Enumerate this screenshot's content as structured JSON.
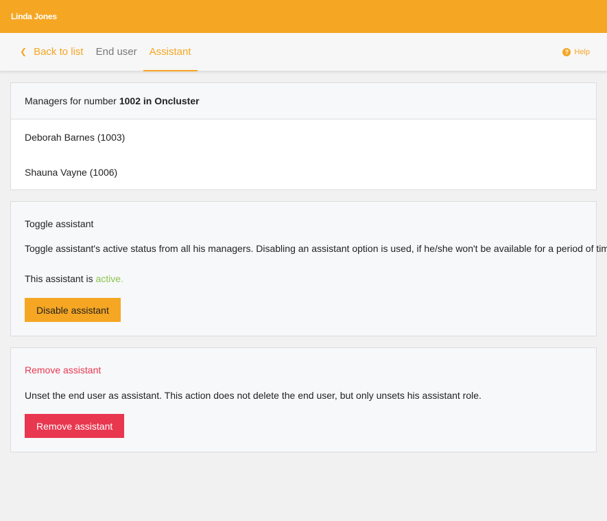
{
  "header": {
    "user_name": "Linda Jones"
  },
  "nav": {
    "back_label": "Back to list",
    "tabs": [
      {
        "label": "End user",
        "active": false
      },
      {
        "label": "Assistant",
        "active": true
      }
    ],
    "help_label": "Help"
  },
  "managers": {
    "header_prefix": "Managers for number",
    "header_number": "1002 in Oncluster",
    "items": [
      {
        "label": "Deborah Barnes (1003)"
      },
      {
        "label": "Shauna Vayne (1006)"
      }
    ]
  },
  "toggle": {
    "title": "Toggle assistant",
    "description": "Toggle assistant's active status from all his managers. Disabling an assistant option is used, if he/she won't be available for a period of time.",
    "status_prefix": "This assistant is",
    "status_value": "active.",
    "button_label": "Disable assistant"
  },
  "remove": {
    "title": "Remove assistant",
    "description": "Unset the end user as assistant. This action does not delete the end user, but only unsets his assistant role.",
    "button_label": "Remove assistant"
  },
  "colors": {
    "accent": "#f5a623",
    "danger": "#e8374f",
    "active_status": "#8bc34a"
  }
}
